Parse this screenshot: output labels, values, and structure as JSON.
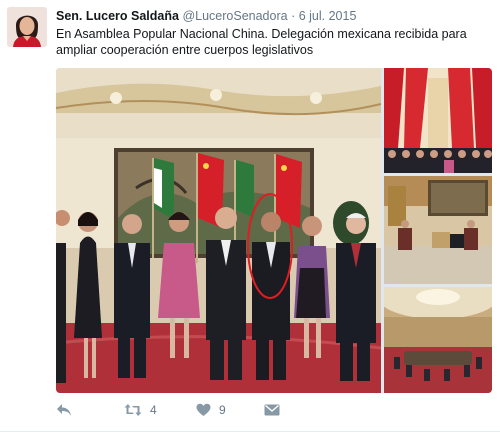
{
  "tweet": {
    "author_name": "Sen. Lucero Saldaña",
    "handle": "@LuceroSenadora",
    "separator": "·",
    "date": "6 jul. 2015",
    "text": "En Asamblea Popular Nacional China. Delegación mexicana recibida para ampliar cooperación entre cuerpos legislativos",
    "media_count": 4
  },
  "actions": {
    "retweets": "4",
    "likes": "9"
  },
  "icons": {
    "reply": "reply-icon",
    "retweet": "retweet-icon",
    "like": "heart-icon",
    "dm": "message-icon"
  },
  "colors": {
    "accent_red": "#d5202a",
    "meta_gray": "#657786",
    "carpet": "#b0303a"
  }
}
